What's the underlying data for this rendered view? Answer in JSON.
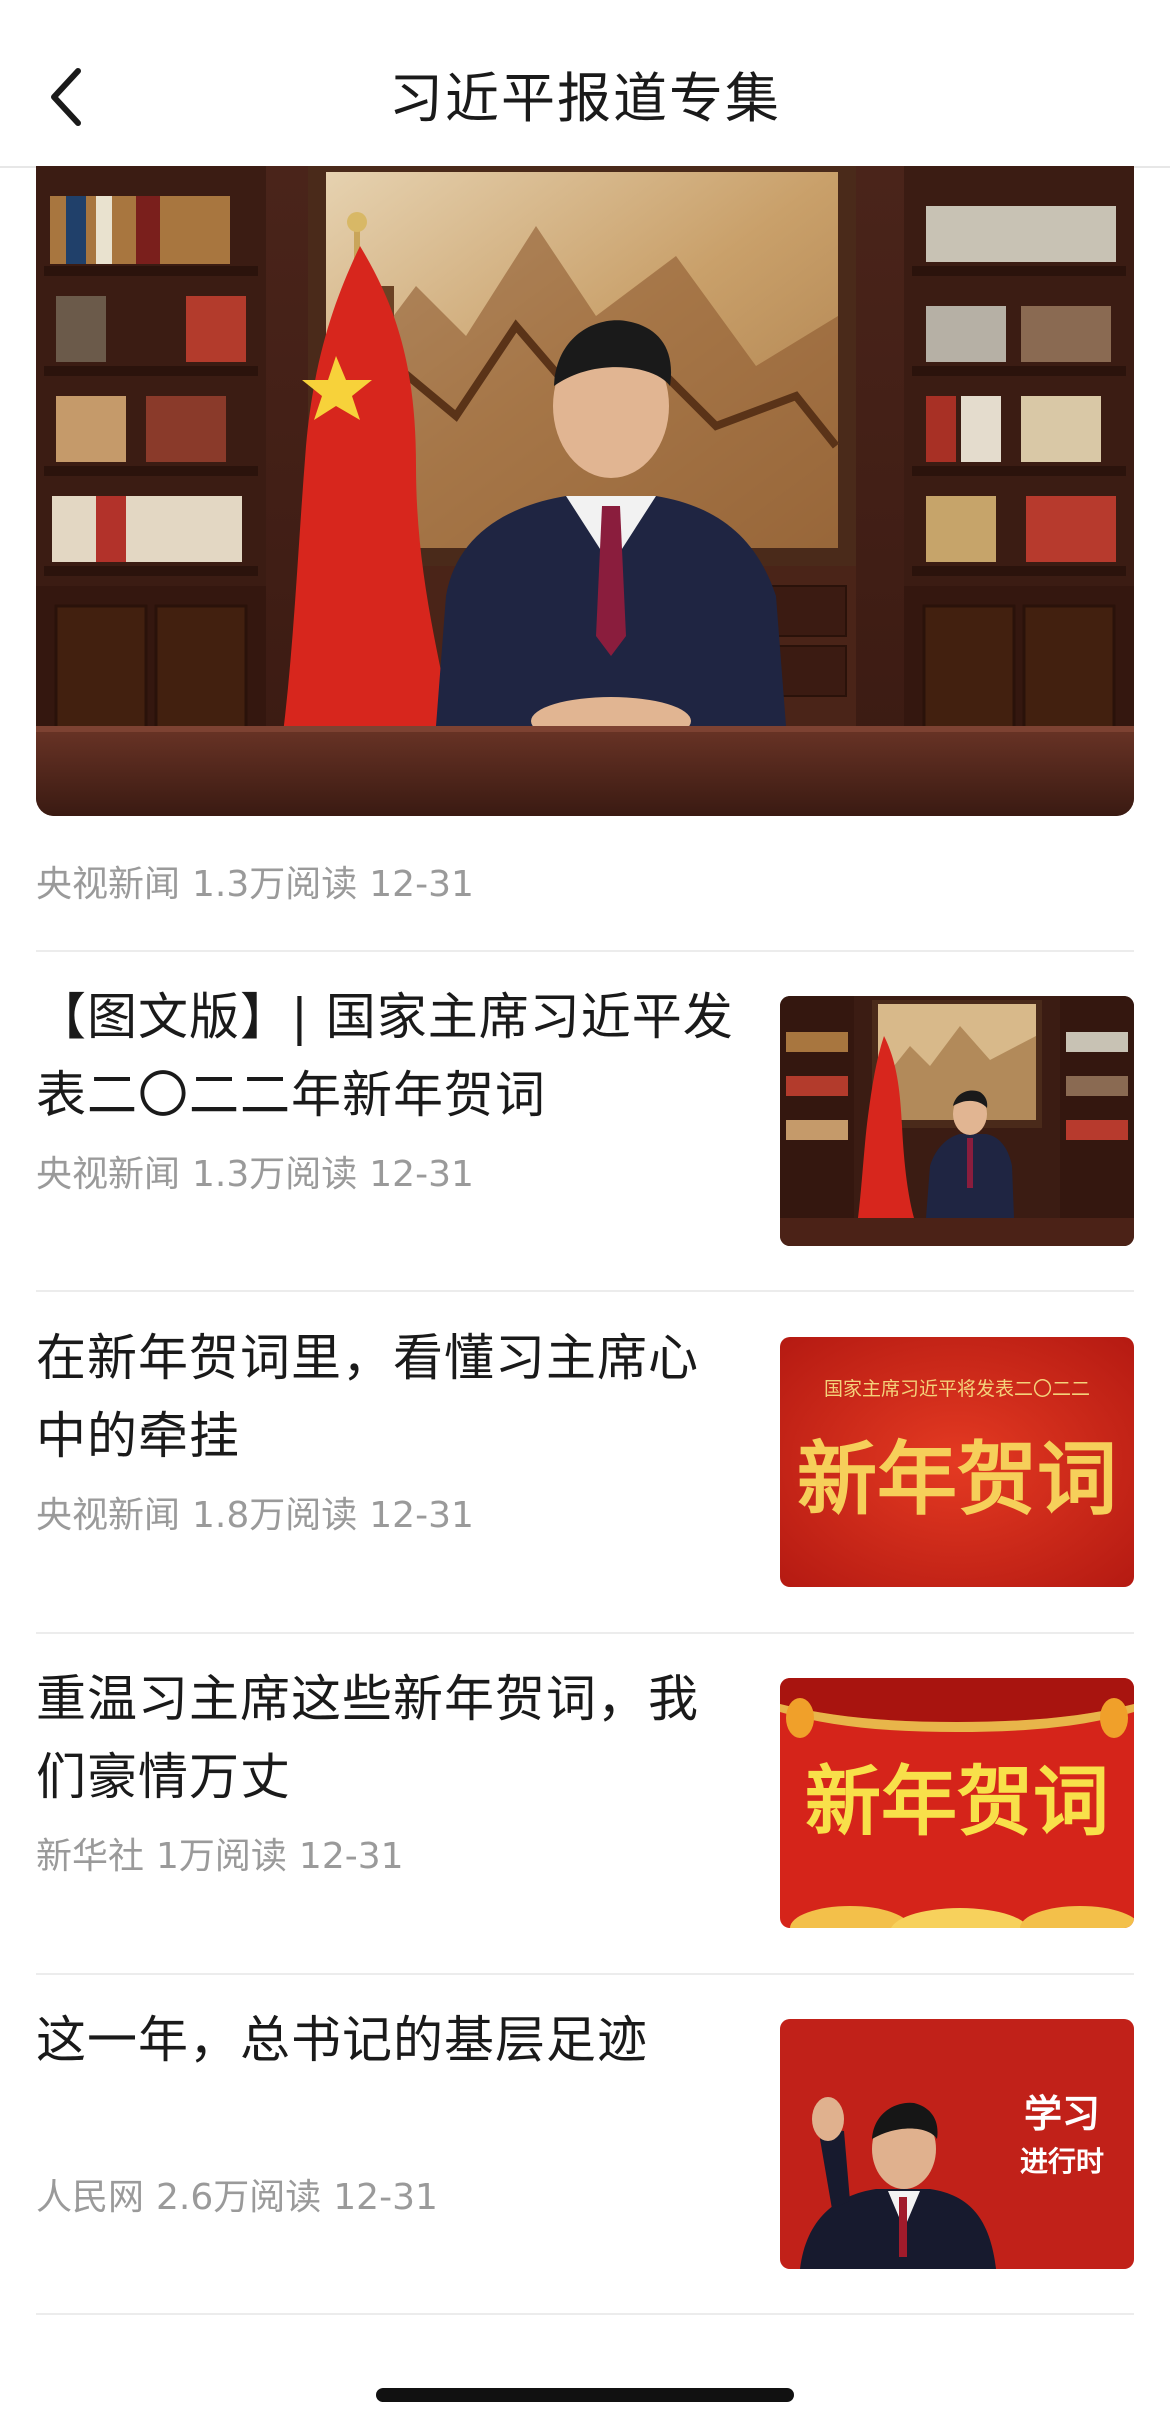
{
  "header": {
    "title": "习近平报道专集",
    "back_icon": "chevron-left-icon"
  },
  "hero": {
    "source": "央视新闻",
    "reads": "1.3万阅读",
    "date": "12-31"
  },
  "articles": [
    {
      "title": "【图文版】| 国家主席习近平发表二〇二二年新年贺词",
      "source": "央视新闻",
      "reads": "1.3万阅读",
      "date": "12-31"
    },
    {
      "title": "在新年贺词里，看懂习主席心中的牵挂",
      "source": "央视新闻",
      "reads": "1.8万阅读",
      "date": "12-31",
      "thumb_caption": "国家主席习近平将发表二〇二二",
      "thumb_text": "新年贺词"
    },
    {
      "title": "重温习主席这些新年贺词，我们豪情万丈",
      "source": "新华社",
      "reads": "1万阅读",
      "date": "12-31",
      "thumb_text": "新年贺词"
    },
    {
      "title": "这一年，总书记的基层足迹",
      "source": "人民网",
      "reads": "2.6万阅读",
      "date": "12-31",
      "thumb_text_line1": "学习",
      "thumb_text_line2": "进行时"
    }
  ],
  "colors": {
    "accent_red": "#d42a1f",
    "meta_gray": "#9a9a9a",
    "divider": "#ececec"
  }
}
